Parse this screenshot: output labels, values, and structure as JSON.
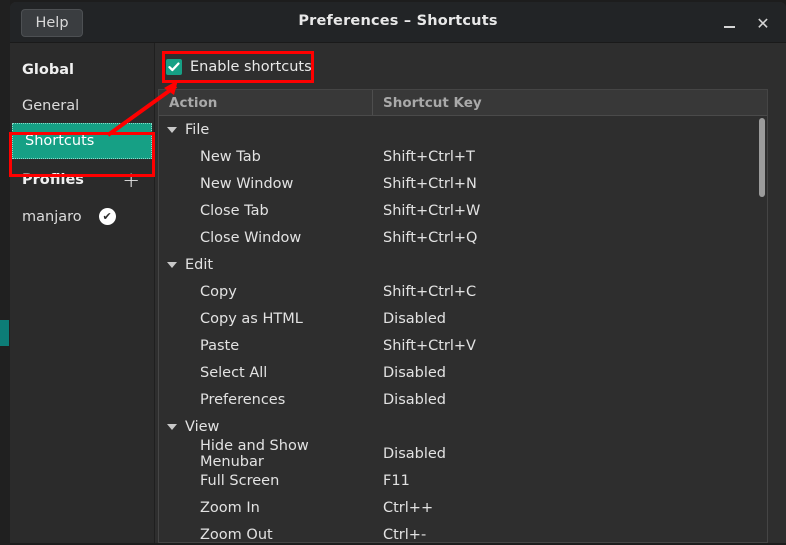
{
  "window": {
    "title": "Preferences – Shortcuts",
    "help_label": "Help",
    "minimize_label": "–",
    "close_label": "✕"
  },
  "sidebar": {
    "global_header": "Global",
    "items": [
      {
        "label": "General",
        "selected": false
      },
      {
        "label": "Shortcuts",
        "selected": true
      }
    ],
    "profiles_header": "Profiles",
    "add_profile_icon": "plus-icon",
    "profiles": [
      {
        "name": "manjaro",
        "default": true,
        "badge_icon": "check-circle-icon"
      }
    ]
  },
  "content": {
    "enable_shortcuts": {
      "label": "Enable shortcuts",
      "checked": true,
      "check_glyph": "✔"
    },
    "table": {
      "columns": [
        "Action",
        "Shortcut Key"
      ],
      "groups": [
        {
          "name": "File",
          "expanded": true,
          "rows": [
            {
              "action": "New Tab",
              "key": "Shift+Ctrl+T"
            },
            {
              "action": "New Window",
              "key": "Shift+Ctrl+N"
            },
            {
              "action": "Close Tab",
              "key": "Shift+Ctrl+W"
            },
            {
              "action": "Close Window",
              "key": "Shift+Ctrl+Q"
            }
          ]
        },
        {
          "name": "Edit",
          "expanded": true,
          "rows": [
            {
              "action": "Copy",
              "key": "Shift+Ctrl+C"
            },
            {
              "action": "Copy as HTML",
              "key": "Disabled"
            },
            {
              "action": "Paste",
              "key": "Shift+Ctrl+V"
            },
            {
              "action": "Select All",
              "key": "Disabled"
            },
            {
              "action": "Preferences",
              "key": "Disabled"
            }
          ]
        },
        {
          "name": "View",
          "expanded": true,
          "rows": [
            {
              "action": "Hide and Show Menubar",
              "key": "Disabled"
            },
            {
              "action": "Full Screen",
              "key": "F11"
            },
            {
              "action": "Zoom In",
              "key": "Ctrl++"
            },
            {
              "action": "Zoom Out",
              "key": "Ctrl+-"
            }
          ]
        }
      ]
    }
  },
  "colors": {
    "accent": "#16a085",
    "annotation": "#ff0000",
    "window_bg": "#2e2e2e",
    "titlebar_bg": "#222426",
    "sidebar_bg": "#2b2b2b"
  }
}
